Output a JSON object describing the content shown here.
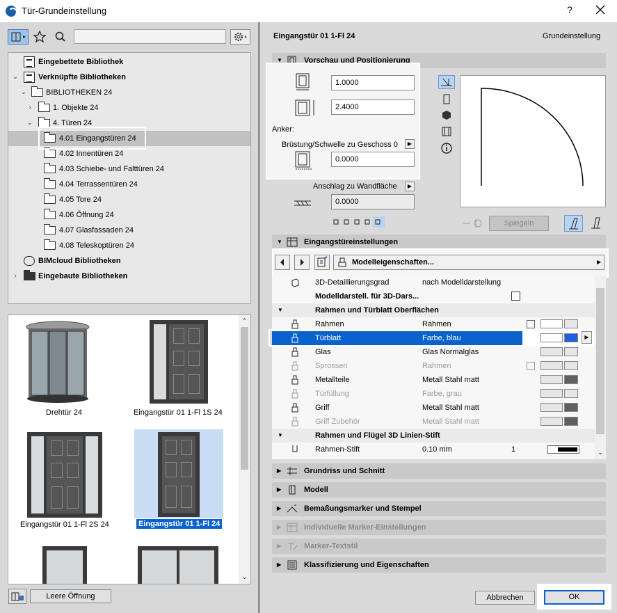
{
  "window": {
    "title": "Tür-Grundeinstellung",
    "help": "?"
  },
  "tree": {
    "items": [
      {
        "label": "Eingebettete Bibliothek"
      },
      {
        "label": "Verknüpfte Bibliotheken"
      },
      {
        "label": "BIBLIOTHEKEN 24"
      },
      {
        "label": "1. Objekte 24"
      },
      {
        "label": "4. Türen 24"
      },
      {
        "label": "4.01 Eingangstüren 24"
      },
      {
        "label": "4.02 Innentüren 24"
      },
      {
        "label": "4.03 Schiebe- und Falttüren 24"
      },
      {
        "label": "4.04 Terrassentüren 24"
      },
      {
        "label": "4.05 Tore 24"
      },
      {
        "label": "4.06 Öffnung 24"
      },
      {
        "label": "4.07 Glasfassaden 24"
      },
      {
        "label": "4.08 Teleskoptüren 24"
      },
      {
        "label": "BIMcloud Bibliotheken"
      },
      {
        "label": "Eingebaute Bibliotheken"
      }
    ]
  },
  "gallery": {
    "items": [
      {
        "label": "Drehtür 24"
      },
      {
        "label": "Eingangstür 01 1-Fl 1S 24"
      },
      {
        "label": "Eingangstür 01 1-Fl 2S 24"
      },
      {
        "label": "Eingangstür 01 1-Fl 24"
      }
    ]
  },
  "bottom_left": {
    "leere_label": "Leere Öffnung"
  },
  "header": {
    "title": "Eingangstür 01 1-Fl 24",
    "subtitle": "Grundeinstellung"
  },
  "sections": {
    "vorschau": "Vorschau und Positionierung",
    "eingang": "Eingangstüreinstellungen",
    "grundriss": "Grundriss und Schnitt",
    "modell": "Modell",
    "bemassung": "Bemaßungsmarker und Stempel",
    "individuelle": "Individuelle Marker-Einstellungen",
    "marker_text": "Marker-Textstil",
    "klass": "Klassifizierung und Eigenschaften"
  },
  "positioning": {
    "width": "1.0000",
    "height": "2.4000",
    "anker_label": "Anker:",
    "bruestung_label": "Brüstung/Schwelle zu Geschoss 0",
    "bruestung_value": "0.0000",
    "anschlag_label": "Anschlag zu Wandfläche",
    "anschlag_value": "0.0000",
    "spiegeln_label": "Spiegeln"
  },
  "eingang": {
    "dropdown_label": "Modelleigenschaften..."
  },
  "props": {
    "rows": [
      {
        "c1": "3D-Detaillierungsgrad",
        "c2": "nach Modelldarstellung"
      },
      {
        "c1": "Modelldarstell. für 3D-Dars..."
      },
      {
        "c1": "Rahmen und Türblatt Oberflächen"
      },
      {
        "c1": "Rahmen",
        "c2": "Rahmen"
      },
      {
        "c1": "Türblatt",
        "c2": "Farbe, blau"
      },
      {
        "c1": "Glas",
        "c2": "Glas Normalglas"
      },
      {
        "c1": "Sprossen",
        "c2": "Rahmen"
      },
      {
        "c1": "Metallteile",
        "c2": "Metall Stahl matt"
      },
      {
        "c1": "Türfüllung",
        "c2": "Farbe, grau"
      },
      {
        "c1": "Griff",
        "c2": "Metall Stahl matt"
      },
      {
        "c1": "Griff Zubehör",
        "c2": "Metall Stahl matt"
      },
      {
        "c1": "Rahmen und Flügel 3D Linien-Stift"
      },
      {
        "c1": "Rahmen-Stift",
        "c2": "0.10 mm",
        "c3": "1"
      }
    ]
  },
  "buttons": {
    "cancel": "Abbrechen",
    "ok": "OK"
  },
  "colors": {
    "selection": "#0a62cc",
    "swatch_blue": "#1f5fe0",
    "swatch_gray": "#606060"
  },
  "icons": [
    "app-icon",
    "close-icon",
    "library-view-icon",
    "star-icon",
    "search-icon",
    "gear-icon"
  ]
}
